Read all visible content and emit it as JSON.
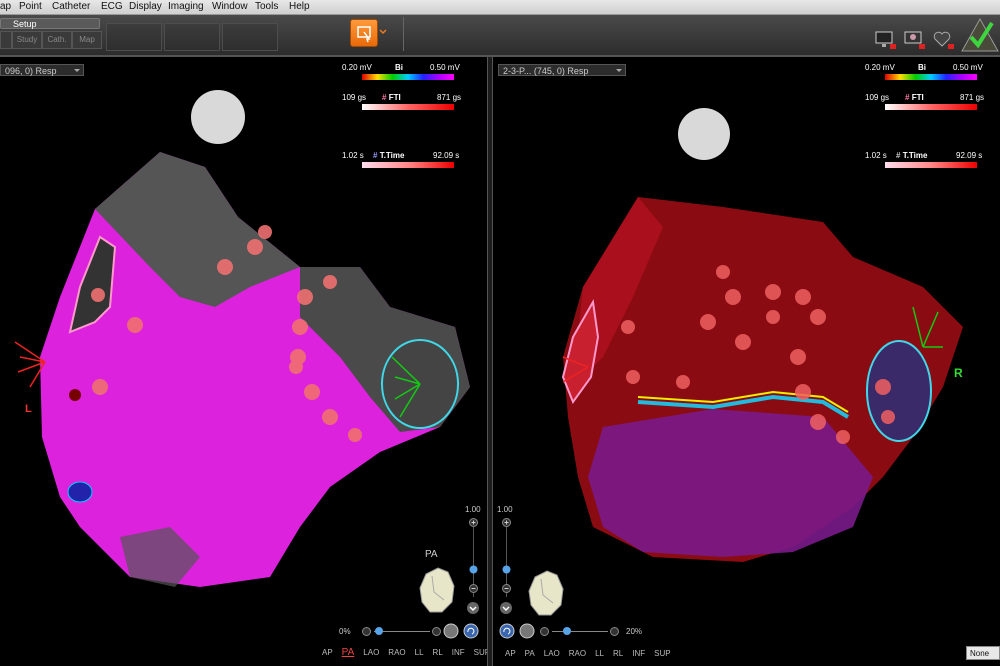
{
  "menu": [
    "ap",
    "Point",
    "Catheter",
    "ECG",
    "Display",
    "Imaging",
    "Window",
    "Tools",
    "Help"
  ],
  "toolbar": {
    "setup_label": "Setup",
    "tabs": [
      "Study",
      "Cath.",
      "Map"
    ]
  },
  "left_view": {
    "map_select": "096, 0) Resp",
    "bi": {
      "min": "0.20 mV",
      "name": "Bi",
      "max": "0.50 mV"
    },
    "fti": {
      "min": "109 gs",
      "name": "FTI",
      "max": "871 gs"
    },
    "ttime": {
      "min": "1.02 s",
      "name": "T.Time",
      "max": "92.09 s"
    },
    "orient_label": "PA",
    "zoom_top": "1.00",
    "pct": "0%",
    "side_label": "L",
    "views": [
      "AP",
      "PA",
      "LAO",
      "RAO",
      "LL",
      "RL",
      "INF",
      "SUP"
    ],
    "active_view": "PA"
  },
  "right_view": {
    "map_select": "2-3-P... (745, 0) Resp",
    "bi": {
      "min": "0.20 mV",
      "name": "Bi",
      "max": "0.50 mV"
    },
    "fti": {
      "min": "109 gs",
      "name": "FTI",
      "max": "871 gs"
    },
    "ttime": {
      "min": "1.02 s",
      "name": "T.Time",
      "max": "92.09 s"
    },
    "zoom_top": "1.00",
    "pct": "20%",
    "side_label": "R",
    "views": [
      "AP",
      "PA",
      "LAO",
      "RAO",
      "LL",
      "RL",
      "INF",
      "SUP"
    ]
  },
  "none_select": "None",
  "colors": {
    "accent_orange": "#f07a1a",
    "map_magenta": "#e020e0",
    "map_red": "#b01010",
    "ring_cyan": "#40d8e8"
  }
}
